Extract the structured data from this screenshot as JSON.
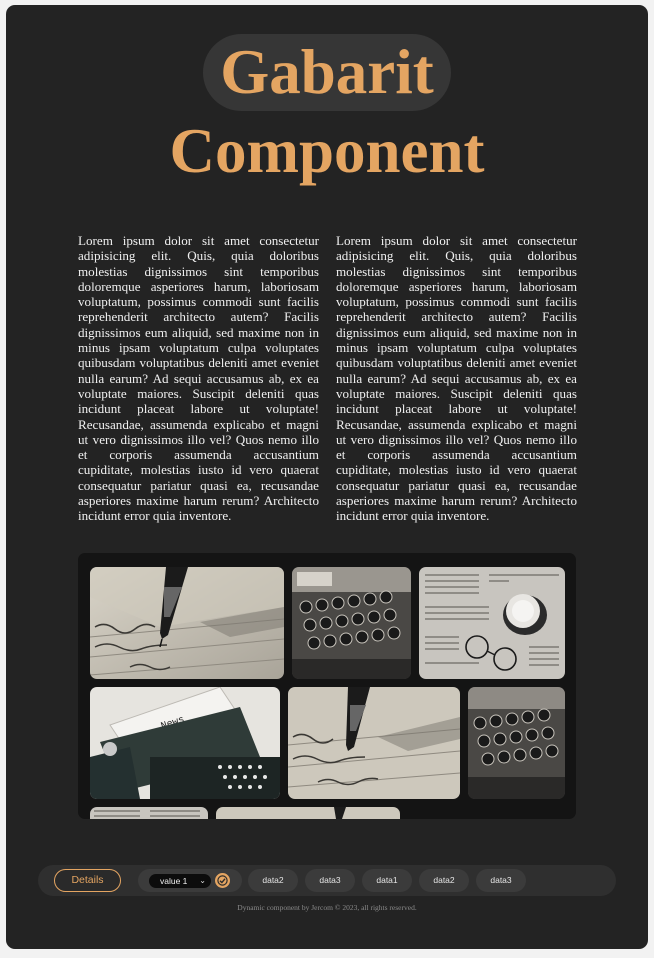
{
  "title": {
    "line1": "Gabarit",
    "line2": "Component"
  },
  "columns": {
    "left": "Lorem ipsum dolor sit amet consectetur adipisicing elit. Quis, quia doloribus molestias dignissimos sint temporibus doloremque asperiores harum, laboriosam voluptatum, possimus commodi sunt facilis reprehenderit architecto autem? Facilis dignissimos eum aliquid, sed maxime non in minus ipsam voluptatum culpa voluptates quibusdam voluptatibus deleniti amet eveniet nulla earum? Ad sequi accusamus ab, ex ea voluptate maiores. Suscipit deleniti quas incidunt placeat labore ut voluptate! Recusandae, assumenda explicabo et magni ut vero dignissimos illo vel? Quos nemo illo et corporis assumenda accusantium cupiditate, molestias iusto id vero quaerat consequatur pariatur quasi ea, recusandae asperiores maxime harum rerum? Architecto incidunt error quia inventore.",
    "right": "Lorem ipsum dolor sit amet consectetur adipisicing elit. Quis, quia doloribus molestias dignissimos sint temporibus doloremque asperiores harum, laboriosam voluptatum, possimus commodi sunt facilis reprehenderit architecto autem? Facilis dignissimos eum aliquid, sed maxime non in minus ipsam voluptatum culpa voluptates quibusdam voluptatibus deleniti amet eveniet nulla earum? Ad sequi accusamus ab, ex ea voluptate maiores. Suscipit deleniti quas incidunt placeat labore ut voluptate! Recusandae, assumenda explicabo et magni ut vero dignissimos illo vel? Quos nemo illo et corporis assumenda accusantium cupiditate, molestias iusto id vero quaerat consequatur pariatur quasi ea, recusandae asperiores maxime harum rerum? Architecto incidunt error quia inventore."
  },
  "gallery": {
    "images": [
      "fountain-pen-writing",
      "typewriter-keys",
      "newspaper-coffee-glasses",
      "typewriter-news-paper",
      "fountain-pen-writing",
      "typewriter-keys",
      "newspaper-coffee-glasses",
      "fountain-pen-writing"
    ],
    "typewriter_paper_text": "News"
  },
  "toolbar": {
    "details_label": "Details",
    "select_value": "value 1",
    "chevron_icon": "chevron-down-icon",
    "confirm_icon": "check-circle-icon",
    "data_items": [
      "data2",
      "data3",
      "data1",
      "data2",
      "data3"
    ]
  },
  "footer": "Dynamic component by Jercom © 2023, all rights reserved.",
  "colors": {
    "accent": "#e4a562",
    "card": "#232323",
    "page": "#f2f2f2",
    "gallery": "#141414"
  }
}
